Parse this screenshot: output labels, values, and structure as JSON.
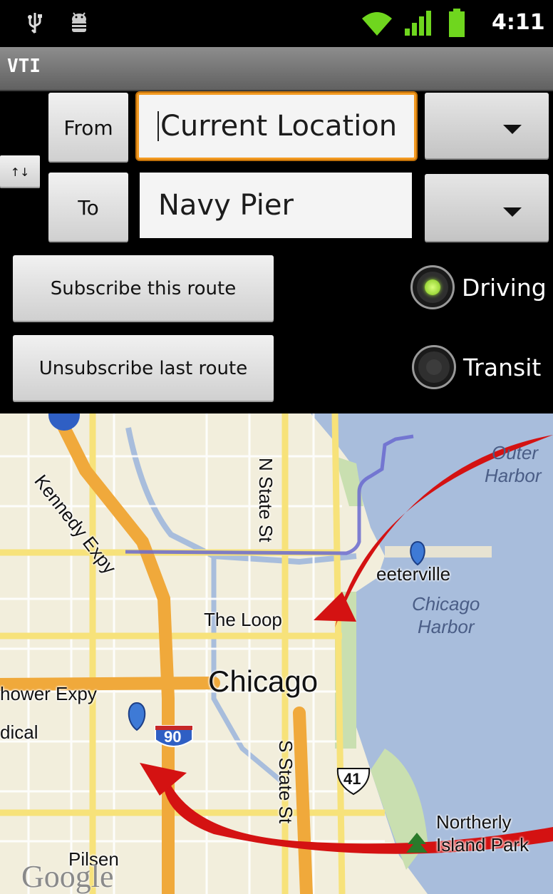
{
  "status_bar": {
    "time": "4:11",
    "icons": [
      "usb-icon",
      "android-debug-icon",
      "wifi-icon",
      "signal-icon",
      "battery-icon"
    ]
  },
  "app": {
    "title": "VTI"
  },
  "form": {
    "from_button": "From",
    "to_button": "To",
    "swap_label": "↑↓",
    "from_value": "Current Location",
    "to_value": "Navy Pier",
    "subscribe_label": "Subscribe this route",
    "unsubscribe_label": "Unsubscribe last route",
    "modes": [
      {
        "label": "Driving",
        "selected": true
      },
      {
        "label": "Transit",
        "selected": false
      }
    ]
  },
  "map": {
    "labels": {
      "kennedy": "Kennedy Expy",
      "nstate": "N State St",
      "outer": "Outer",
      "harbor": "Harbor",
      "streeterville": "eeterville",
      "chicago_harbor_1": "Chicago",
      "chicago_harbor_2": "Harbor",
      "loop": "The Loop",
      "chicago": "Chicago",
      "eisenhower": "hower Expy",
      "medical": "dical",
      "shield_90": "90",
      "sstate": "S State St",
      "shield_41": "41",
      "northerly_1": "Northerly",
      "northerly_2": "Island Park",
      "pilsen": "Pilsen",
      "google": "Google"
    },
    "colors": {
      "route": "#6a6acf",
      "arrow": "#e01010",
      "water": "#a8bddc"
    }
  }
}
